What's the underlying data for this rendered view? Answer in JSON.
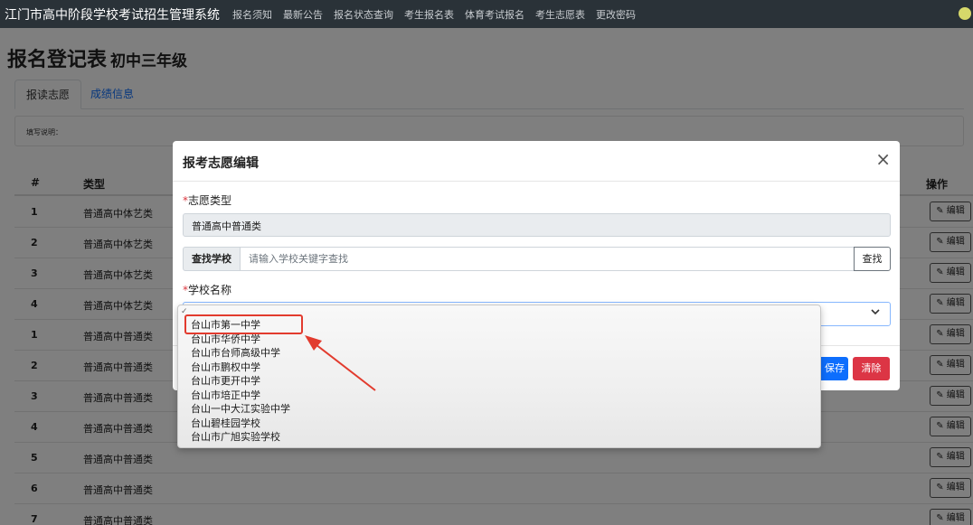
{
  "navbar": {
    "brand": "江门市高中阶段学校考试招生管理系统",
    "items": [
      "报名须知",
      "最新公告",
      "报名状态查询",
      "考生报名表",
      "体育考试报名",
      "考生志愿表",
      "更改密码"
    ]
  },
  "page": {
    "title": "报名登记表",
    "grade": "初中三年级",
    "tabs": [
      "报读志愿",
      "成绩信息"
    ],
    "note_label": "填写说明："
  },
  "table": {
    "headers": {
      "no": "#",
      "type": "类型",
      "action": "操作"
    },
    "edit_label": "✎ 编辑",
    "rows": [
      {
        "no": "1",
        "type": "普通高中体艺类"
      },
      {
        "no": "2",
        "type": "普通高中体艺类"
      },
      {
        "no": "3",
        "type": "普通高中体艺类"
      },
      {
        "no": "4",
        "type": "普通高中体艺类"
      },
      {
        "no": "1",
        "type": "普通高中普通类"
      },
      {
        "no": "2",
        "type": "普通高中普通类"
      },
      {
        "no": "3",
        "type": "普通高中普通类"
      },
      {
        "no": "4",
        "type": "普通高中普通类"
      },
      {
        "no": "5",
        "type": "普通高中普通类"
      },
      {
        "no": "6",
        "type": "普通高中普通类"
      },
      {
        "no": "7",
        "type": "普通高中普通类"
      }
    ]
  },
  "modal": {
    "title": "报考志愿编辑",
    "close": "×",
    "type_label": "志愿类型",
    "type_value": "普通高中普通类",
    "search_prefix": "查找学校",
    "search_placeholder": "请输入学校关键字查找",
    "search_button": "查找",
    "school_label": "学校名称",
    "save": "保存",
    "clear": "清除"
  },
  "dropdown": {
    "options": [
      "台山市第一中学",
      "台山市华侨中学",
      "台山市台师高级中学",
      "台山市鹏权中学",
      "台山市更开中学",
      "台山市培正中学",
      "台山一中大江实验中学",
      "台山碧桂园学校",
      "台山市广旭实验学校"
    ],
    "highlighted": "台山市第一中学"
  },
  "colors": {
    "navbar": "#2a3238",
    "primary": "#0d6efd",
    "danger": "#dc3545",
    "annotation": "#e23b2e"
  },
  "icons": {
    "edit": "pencil-icon",
    "close": "close-icon",
    "select": "chevron-down-icon",
    "user": "user-icon"
  }
}
